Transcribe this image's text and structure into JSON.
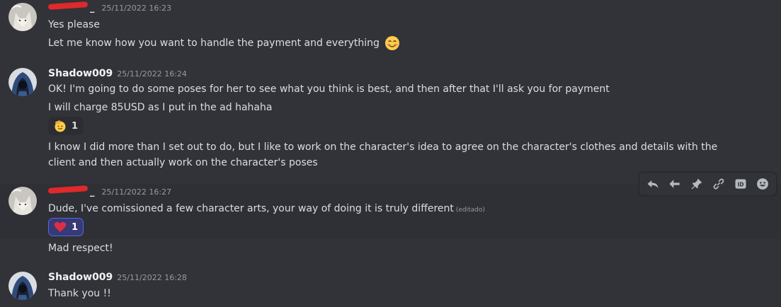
{
  "messages": [
    {
      "author": "_",
      "author_redacted": true,
      "timestamp": "25/11/2022 16:23",
      "lines": [
        "Yes please",
        "Let me know how you want to handle the payment and everything"
      ],
      "inline_emoji": "smiling-face-emoji"
    },
    {
      "author": "Shadow009",
      "timestamp": "25/11/2022 16:24",
      "lines": [
        "OK! I'm going to do some poses for her to see what you think is best, and then after that I'll ask you for payment",
        "I will charge 85USD as I put in the ad hahaha",
        "I know I did more than I set out to do, but I like to work on the character's idea to agree on the character's clothes and details with the client and then actually work on the character's poses"
      ],
      "reaction": {
        "emoji": "saluting-face-emoji",
        "count": "1"
      }
    },
    {
      "author": "_",
      "author_redacted": true,
      "timestamp": "25/11/2022 16:27",
      "lines": [
        "Dude, I've comissioned a few character arts, your way of doing it is truly different",
        "Mad respect!"
      ],
      "edited_label": "(editado)",
      "reaction": {
        "emoji": "heart-emoji",
        "count": "1",
        "active": true
      }
    },
    {
      "author": "Shadow009",
      "timestamp": "25/11/2022 16:28",
      "lines": [
        "Thank you !!"
      ]
    }
  ],
  "toolbar": {
    "icons": [
      "reply-icon",
      "forward-icon",
      "pin-icon",
      "link-icon",
      "copy-id-icon",
      "add-reaction-icon"
    ]
  },
  "colors": {
    "background": "#313338",
    "hover_background": "#2e3035",
    "username": "#f2f3f5",
    "timestamp": "#949ba4",
    "text": "#dbdee1",
    "reaction_active": "#5865f2",
    "redaction": "#e0292a"
  }
}
